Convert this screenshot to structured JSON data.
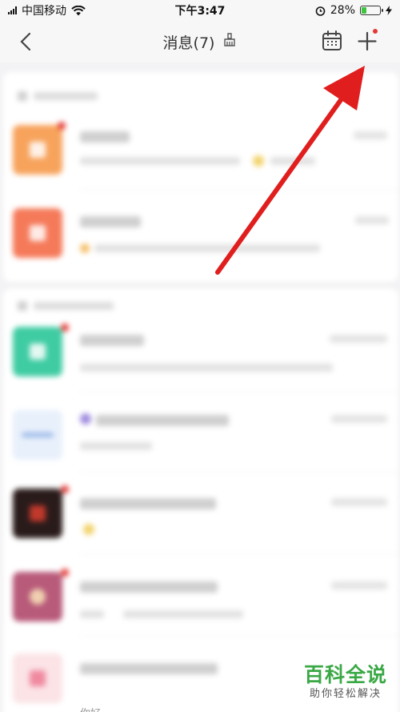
{
  "status_bar": {
    "carrier": "中国移动",
    "time": "下午3:47",
    "battery_percent_text": "28%",
    "battery_level": 0.28
  },
  "nav": {
    "title": "消息(7)"
  },
  "watermark": {
    "title": "百科全说",
    "subtitle": "助你轻松解决"
  },
  "bottom_partial_text": "你好",
  "colors": {
    "arrow": "#e01e1e",
    "avatar_orange": "#f7a35c",
    "avatar_red": "#f57a5a",
    "avatar_teal": "#3fcca3",
    "watermark_green": "#3aa845"
  }
}
